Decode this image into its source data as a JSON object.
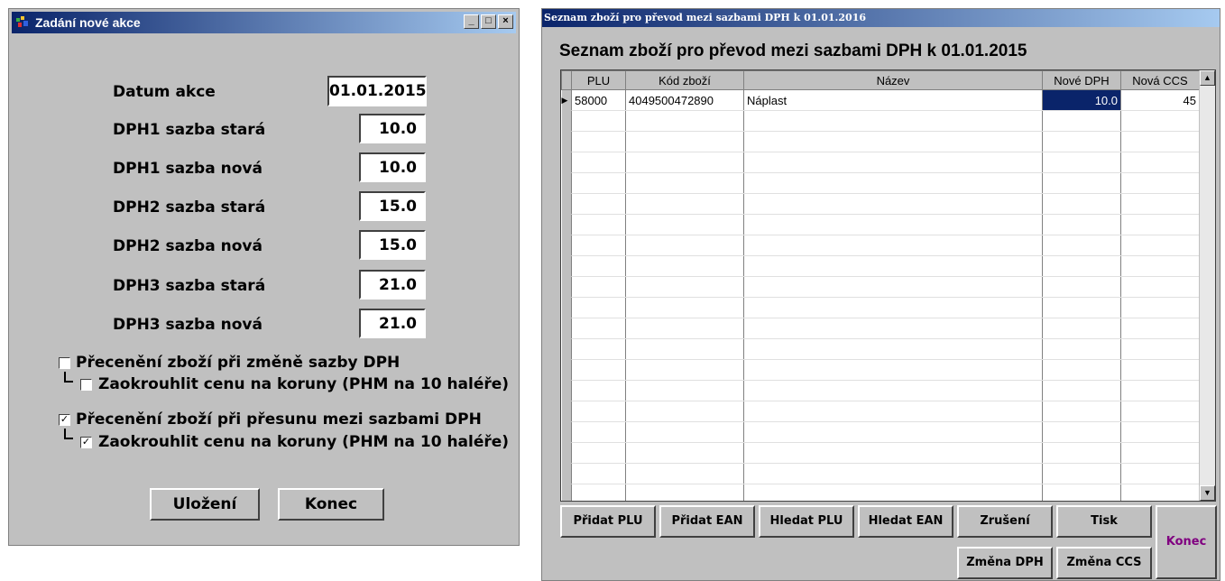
{
  "dialog": {
    "title": "Zadání nové akce",
    "title_buttons": [
      "_",
      "□",
      "×"
    ],
    "date_label": "Datum akce",
    "date_value": "01.01.2015",
    "fields": [
      {
        "label": "DPH1 sazba stará",
        "value": "10.0"
      },
      {
        "label": "DPH1 sazba nová",
        "value": "10.0"
      },
      {
        "label": "DPH2 sazba stará",
        "value": "15.0"
      },
      {
        "label": "DPH2 sazba nová",
        "value": "15.0"
      },
      {
        "label": "DPH3 sazba stará",
        "value": "21.0"
      },
      {
        "label": "DPH3 sazba nová",
        "value": "21.0"
      }
    ],
    "checks": [
      {
        "label": "Přecenění zboží při změně sazby DPH",
        "checked": false
      },
      {
        "label": "Zaokrouhlit cenu na koruny (PHM na 10 haléře)",
        "checked": false
      },
      {
        "label": "Přecenění zboží při přesunu mezi sazbami DPH",
        "checked": true
      },
      {
        "label": "Zaokrouhlit cenu na koruny (PHM na 10 haléře)",
        "checked": true
      }
    ],
    "save_label": "Uložení",
    "close_label": "Konec"
  },
  "list": {
    "title": "Seznam zboží pro převod mezi sazbami DPH k 01.01.2016",
    "heading": "Seznam zboží pro převod mezi sazbami DPH k 01.01.2015",
    "columns": [
      "PLU",
      "Kód zboží",
      "Název",
      "Nové DPH",
      "Nová CCS"
    ],
    "rows": [
      [
        "58000",
        "4049500472890",
        "Náplast",
        "10.0",
        "45"
      ]
    ],
    "buttons": {
      "add_plu": "Přidat PLU",
      "add_ean": "Přidat EAN",
      "find_plu": "Hledat PLU",
      "find_ean": "Hledat EAN",
      "cancel": "Zrušení",
      "print": "Tisk",
      "change_vat": "Změna DPH",
      "change_ccs": "Změna CCS",
      "close": "Konec"
    },
    "accent": "#800080"
  }
}
